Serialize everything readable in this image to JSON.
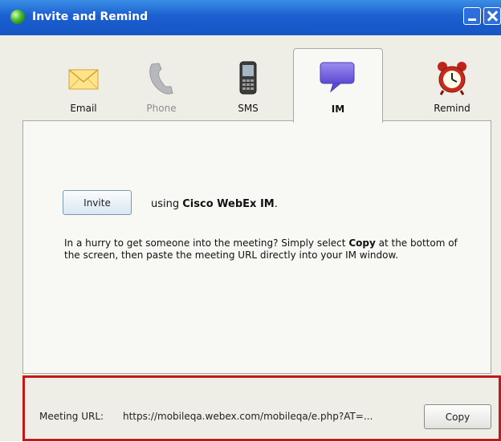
{
  "window": {
    "title": "Invite and Remind"
  },
  "tabs": [
    {
      "label": "Email",
      "icon": "envelope-icon",
      "state": "enabled"
    },
    {
      "label": "Phone",
      "icon": "phone-icon",
      "state": "disabled"
    },
    {
      "label": "SMS",
      "icon": "mobile-phone-icon",
      "state": "enabled"
    },
    {
      "label": "IM",
      "icon": "chat-bubble-icon",
      "state": "selected"
    },
    {
      "label": "Remind",
      "icon": "alarm-clock-icon",
      "state": "enabled"
    }
  ],
  "im_panel": {
    "invite_label": "Invite",
    "using_prefix": "using",
    "service_name": "Cisco WebEx IM",
    "using_suffix": ".",
    "help_before": "In a hurry to get someone into the meeting? Simply select",
    "help_bold": "Copy",
    "help_after": "at the bottom of the screen, then paste the meeting URL directly into your IM window."
  },
  "meeting": {
    "url_label": "Meeting URL:",
    "url_value": "https://mobileqa.webex.com/mobileqa/e.php?AT=...",
    "copy_label": "Copy"
  },
  "colors": {
    "title_bar": "#1c5fd0",
    "highlight_border": "#c51818",
    "panel_background": "#f8f8f4"
  }
}
